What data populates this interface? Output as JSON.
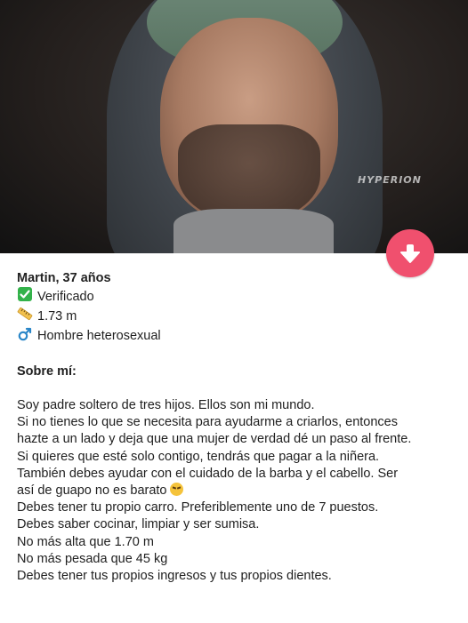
{
  "photo": {
    "watermark": "HYPERION"
  },
  "profile": {
    "name": "Martin, 37 años",
    "verified": "Verificado",
    "height": "1.73 m",
    "orientation": "Hombre heterosexual",
    "about_title": "Sobre mí:",
    "about_lines": [
      "Soy padre soltero de tres hijos. Ellos son mi mundo.",
      "Si no tienes lo que se necesita para ayudarme a criarlos, entonces",
      "hazte a un lado y deja que una mujer de verdad dé un paso al frente.",
      "Si quieres que esté solo contigo, tendrás que pagar a la niñera.",
      "También debes ayudar con el cuidado de la barba y el cabello. Ser",
      "así de guapo no es barato",
      "Debes tener tu propio carro. Preferiblemente uno de 7 puestos.",
      "Debes saber cocinar, limpiar y ser sumisa.",
      "No más alta que 1.70 m",
      "No más pesada que 45 kg",
      "Debes tener tus propios ingresos y tus propios dientes."
    ]
  },
  "icons": {
    "verified": "check-box-icon",
    "height": "ruler-icon",
    "orientation": "male-symbol-icon",
    "action": "arrow-down-icon",
    "emoji": "unamused-face-icon"
  },
  "colors": {
    "action_button": "#f0506e",
    "verified_check": "#33b24a"
  }
}
